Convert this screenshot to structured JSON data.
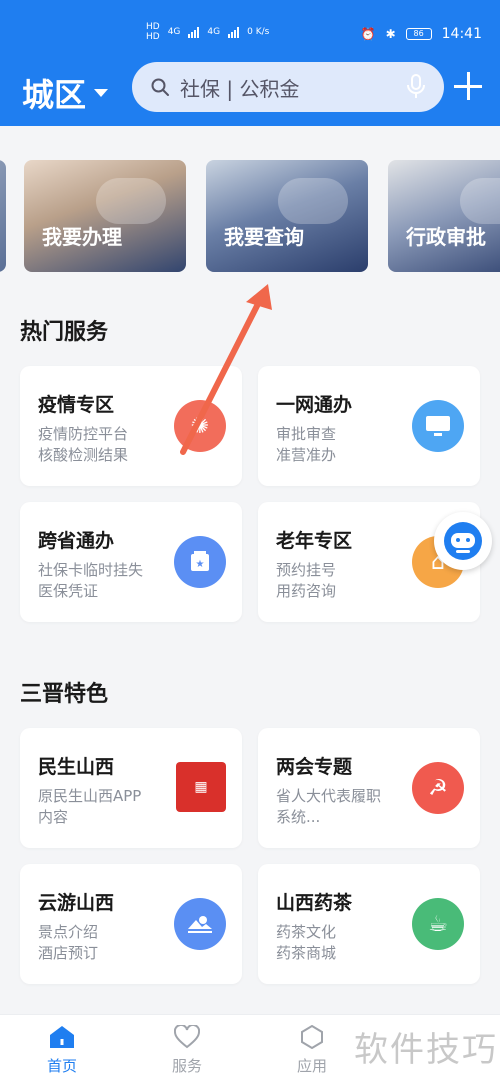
{
  "status": {
    "left_labels": [
      "HD",
      "HD",
      "4G",
      "4G",
      "0 K/s"
    ],
    "time": "14:41",
    "battery": "86"
  },
  "header": {
    "city": "城区",
    "search_placeholder": "社保 | 公积金",
    "brand_color": "#1f7ef0"
  },
  "banners": [
    {
      "label": ""
    },
    {
      "label": "我要办理"
    },
    {
      "label": "我要查询"
    },
    {
      "label": "行政审批"
    }
  ],
  "hot_services": {
    "title": "热门服务",
    "cards": [
      {
        "title": "疫情专区",
        "sub": "疫情防控平台\n核酸检测结果",
        "icon": "virus-icon",
        "color": "#f26d5b"
      },
      {
        "title": "一网通办",
        "sub": "审批审查\n准营准办",
        "icon": "monitor-icon",
        "color": "#4ea6f3"
      },
      {
        "title": "跨省通办",
        "sub": "社保卡临时挂失\n医保凭证",
        "icon": "card-icon",
        "color": "#5b8ff4"
      },
      {
        "title": "老年专区",
        "sub": "预约挂号\n用药咨询",
        "icon": "home-icon",
        "color": "#f6a646"
      }
    ]
  },
  "shanxi": {
    "title": "三晋特色",
    "cards": [
      {
        "title": "民生山西",
        "sub": "原民生山西APP\n内容",
        "icon": "minsheng-seal-icon",
        "color": "#d9302b"
      },
      {
        "title": "两会专题",
        "sub": "省人大代表履职\n系统...",
        "icon": "party-emblem-icon",
        "color": "#f05a4f"
      },
      {
        "title": "云游山西",
        "sub": "景点介绍\n酒店预订",
        "icon": "landscape-icon",
        "color": "#5a8ff3"
      },
      {
        "title": "山西药茶",
        "sub": "药茶文化\n药茶商城",
        "icon": "tea-cup-icon",
        "color": "#49bb78"
      }
    ]
  },
  "nav": {
    "items": [
      {
        "label": "首页",
        "icon": "home-icon",
        "active": true
      },
      {
        "label": "服务",
        "icon": "heart-icon",
        "active": false
      },
      {
        "label": "应用",
        "icon": "hexagon-icon",
        "active": false
      }
    ]
  },
  "watermark": "软件技巧"
}
